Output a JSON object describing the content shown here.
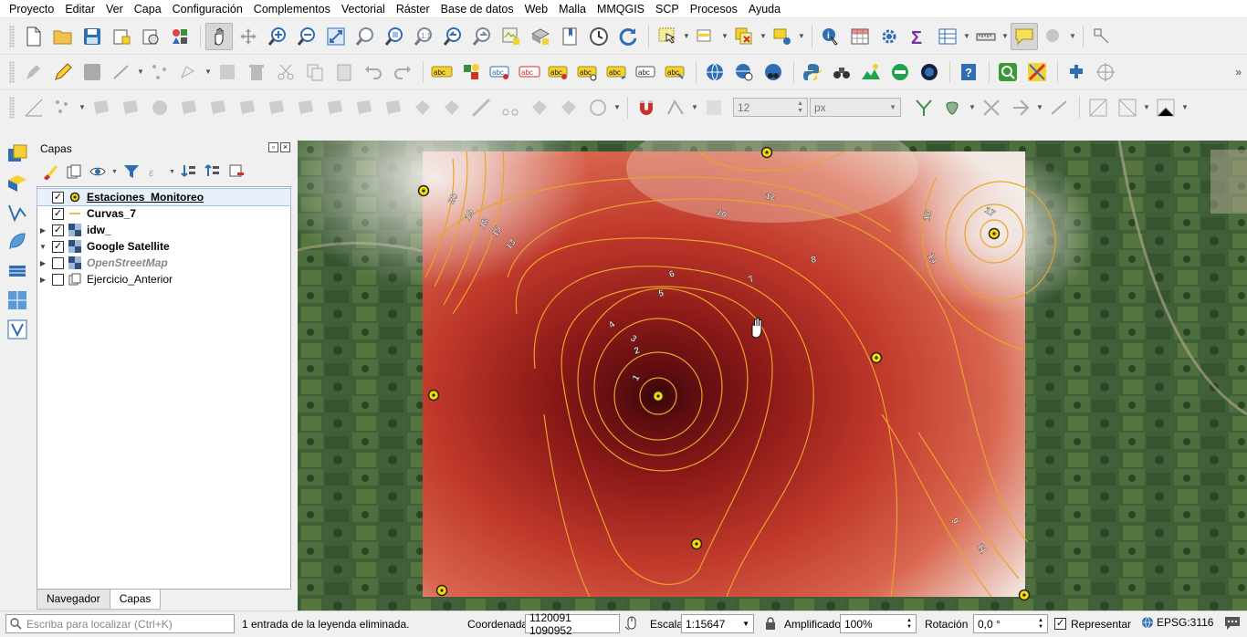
{
  "menu": [
    "Proyecto",
    "Editar",
    "Ver",
    "Capa",
    "Configuración",
    "Complementos",
    "Vectorial",
    "Ráster",
    "Base de datos",
    "Web",
    "Malla",
    "MMQGIS",
    "SCP",
    "Procesos",
    "Ayuda"
  ],
  "toolbar3": {
    "size_value": "12",
    "unit_value": "px"
  },
  "panel": {
    "title": "Capas",
    "layers": [
      {
        "name": "Estaciones_Monitoreo",
        "checked": true,
        "expandable": false,
        "icon": "point-layer-icon"
      },
      {
        "name": "Curvas_7",
        "checked": true,
        "expandable": false,
        "icon": "line-layer-icon"
      },
      {
        "name": "idw_",
        "checked": true,
        "expandable": true,
        "icon": "raster-layer-icon"
      },
      {
        "name": "Google Satellite",
        "checked": true,
        "expandable": true,
        "icon": "raster-layer-icon"
      },
      {
        "name": "OpenStreetMap",
        "checked": false,
        "expandable": true,
        "icon": "raster-layer-icon"
      },
      {
        "name": "Ejercicio_Anterior",
        "checked": false,
        "expandable": true,
        "icon": "group-icon"
      }
    ],
    "tabs": [
      "Navegador",
      "Capas"
    ],
    "active_tab": "Capas"
  },
  "map": {
    "contour_labels": [
      "20",
      "19",
      "18",
      "15",
      "13",
      "12",
      "10",
      "8",
      "7",
      "6",
      "5",
      "4",
      "3",
      "2",
      "1",
      "16",
      "17",
      "14",
      "9",
      "11"
    ],
    "colors": {
      "idw_low": "#5e0d10",
      "idw_mid": "#c0392b",
      "idw_high": "#f2e8e2",
      "contour": "#e8a32a",
      "station_fill": "#f5d90a"
    }
  },
  "status": {
    "locator_placeholder": "Escriba para localizar (Ctrl+K)",
    "message": "1 entrada de la leyenda eliminada.",
    "coord_label": "Coordenada",
    "coord_value": "1120091  1090952",
    "scale_label": "Escala",
    "scale_value": "1:15647",
    "magnifier_label": "Amplificador",
    "magnifier_value": "100%",
    "rotation_label": "Rotación",
    "rotation_value": "0,0 °",
    "render_label": "Representar",
    "crs": "EPSG:3116"
  }
}
